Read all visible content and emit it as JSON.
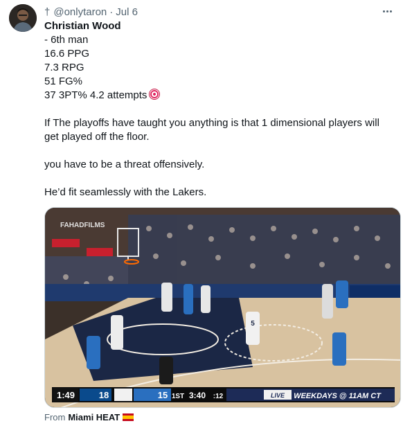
{
  "tweet": {
    "prefix_glyph": "†",
    "handle": "@onlytaron",
    "separator": "·",
    "date": "Jul 6",
    "lines": {
      "name": "Christian Wood",
      "l1": "- 6th man",
      "l2": "16.6 PPG",
      "l3": "7.3 RPG",
      "l4": "51 FG%",
      "l5": "37 3PT% 4.2 attempts",
      "p2": "If The playoffs have taught you anything is that 1 dimensional players will",
      "p2b": "get played off the floor.",
      "p3": "you have to be a threat offensively.",
      "p4": "He’d fit seamlessly with the Lakers."
    },
    "emoji": "direct-hit-target",
    "source_prefix": "From",
    "source_name": "Miami HEAT",
    "source_flag": "spain-flag"
  },
  "media": {
    "watermark": "FAHADFILMS",
    "scorebug": {
      "clock": "1:49",
      "away_score": "18",
      "home_score": "15",
      "quarter": "1ST",
      "game_clock": "3:40",
      "shot_clock": ":12",
      "promo": "WEEKDAYS @ 11AM CT",
      "live_tag": "LIVE",
      "promo_color": "#1d2b57"
    },
    "jersey_numbers": {
      "white_player": "5"
    },
    "colors": {
      "court": "#d8c2a0",
      "paint": "#1b2745",
      "away_blue": "#0a4a8c",
      "home_blue": "#2a6fbf"
    }
  }
}
